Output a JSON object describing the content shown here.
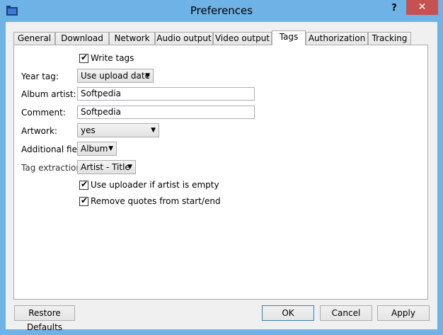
{
  "window": {
    "title": "Preferences",
    "help_label": "?",
    "close_label": "✕"
  },
  "tabs": [
    {
      "label": "General"
    },
    {
      "label": "Download"
    },
    {
      "label": "Network"
    },
    {
      "label": "Audio output"
    },
    {
      "label": "Video output"
    },
    {
      "label": "Tags"
    },
    {
      "label": "Authorization"
    },
    {
      "label": "Tracking"
    }
  ],
  "tags": {
    "write_tags": {
      "label": "Write tags",
      "checked": true
    },
    "year_tag": {
      "label": "Year tag:",
      "value": "Use upload date"
    },
    "album_artist": {
      "label": "Album artist:",
      "value": "Softpedia"
    },
    "comment": {
      "label": "Comment:",
      "value": "Softpedia"
    },
    "artwork": {
      "label": "Artwork:",
      "value": "yes"
    },
    "additional_field": {
      "label": "Additional field:",
      "value": "Album"
    },
    "tag_extraction": {
      "label": "Tag extraction:",
      "value": "Artist - Title"
    },
    "use_uploader": {
      "label": "Use uploader if artist is empty",
      "checked": true
    },
    "remove_quotes": {
      "label": "Remove quotes from start/end",
      "checked": true
    }
  },
  "footer": {
    "restore_defaults": "Restore Defaults",
    "ok": "OK",
    "cancel": "Cancel",
    "apply": "Apply"
  },
  "icons": {
    "dropdown": "▼",
    "check": "✔"
  },
  "colors": {
    "titlebar": "#6fb2e6",
    "close": "#c75050"
  }
}
